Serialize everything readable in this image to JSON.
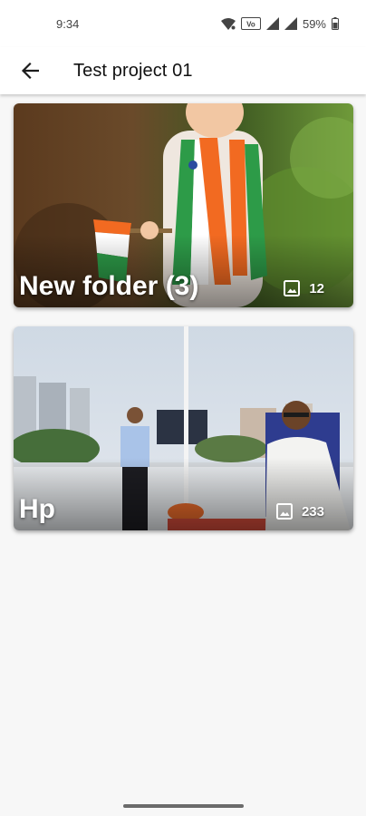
{
  "status_bar": {
    "time": "9:34",
    "battery": "59%",
    "icons": [
      "wifi-icon",
      "volte-icon",
      "signal-icon",
      "signal-icon",
      "battery-icon"
    ]
  },
  "app_bar": {
    "title": "Test project 01",
    "back_icon": "arrow-back-icon"
  },
  "folders": [
    {
      "name": "New folder (3)",
      "count": "12",
      "icon": "image-icon"
    },
    {
      "name": "Hp",
      "count": "233",
      "icon": "image-icon"
    }
  ],
  "colors": {
    "background": "#f7f7f7",
    "app_bar": "#ffffff",
    "text": "#111111"
  }
}
